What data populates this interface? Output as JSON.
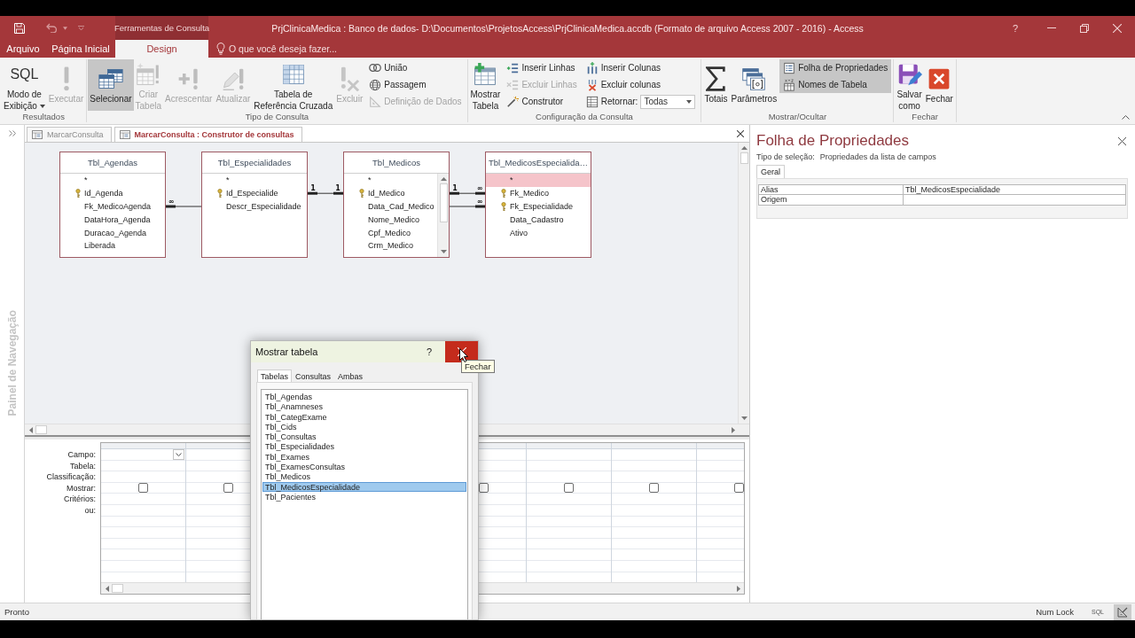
{
  "title_bar": {
    "context_label": "Ferramentas de Consulta",
    "title": "PrjClinicaMedica : Banco de dados- D:\\Documentos\\ProjetosAccess\\PrjClinicaMedica.accdb (Formato de arquivo Access 2007 - 2016) - Access",
    "help": "?"
  },
  "ribbon_tabs": [
    {
      "label": "Arquivo",
      "selected": false
    },
    {
      "label": "Página Inicial",
      "selected": false
    },
    {
      "label": "Design",
      "selected": true
    }
  ],
  "tell_me": {
    "placeholder": "O que você deseja fazer..."
  },
  "ribbon_groups": [
    {
      "label": "Resultados",
      "items": [
        {
          "kind": "large",
          "label": "Modo de\nExibição",
          "icon_text": "SQL",
          "dropdown": true,
          "selected": false,
          "disabled": false
        },
        {
          "kind": "large",
          "label": "Executar",
          "selected": false,
          "disabled": true
        }
      ]
    },
    {
      "label": "Tipo de Consulta",
      "items": [
        {
          "kind": "large",
          "label": "Selecionar",
          "selected": true,
          "disabled": false
        },
        {
          "kind": "large",
          "label": "Criar\nTabela",
          "selected": false,
          "disabled": true
        },
        {
          "kind": "large",
          "label": "Acrescentar",
          "selected": false,
          "disabled": true
        },
        {
          "kind": "large",
          "label": "Atualizar",
          "selected": false,
          "disabled": true
        },
        {
          "kind": "large",
          "label": "Tabela de\nReferência Cruzada",
          "selected": false,
          "disabled": false
        },
        {
          "kind": "large",
          "label": "Excluir",
          "selected": false,
          "disabled": true
        },
        {
          "kind": "stack",
          "items": [
            {
              "kind": "small",
              "label": "União",
              "selected": false,
              "disabled": false
            },
            {
              "kind": "small",
              "label": "Passagem",
              "selected": false,
              "disabled": false
            },
            {
              "kind": "small",
              "label": "Definição de Dados",
              "selected": false,
              "disabled": true
            }
          ]
        }
      ]
    },
    {
      "label": "Configuração da Consulta",
      "items": [
        {
          "kind": "large",
          "label": "Mostrar\nTabela",
          "selected": false,
          "disabled": false
        },
        {
          "kind": "stack",
          "items": [
            {
              "kind": "small",
              "label": "Inserir Linhas",
              "selected": false,
              "disabled": false
            },
            {
              "kind": "small",
              "label": "Excluir Linhas",
              "selected": false,
              "disabled": true
            },
            {
              "kind": "small",
              "label": "Construtor",
              "selected": false,
              "disabled": false
            }
          ]
        },
        {
          "kind": "stack",
          "items": [
            {
              "kind": "small",
              "label": "Inserir Colunas",
              "selected": false,
              "disabled": false
            },
            {
              "kind": "small",
              "label": "Excluir colunas",
              "selected": false,
              "disabled": false
            },
            {
              "kind": "combo",
              "label": "Retornar:",
              "value": "Todas",
              "disabled": false
            }
          ]
        }
      ]
    },
    {
      "label": "Mostrar/Ocultar",
      "items": [
        {
          "kind": "large",
          "label": "Totais",
          "selected": false,
          "disabled": false
        },
        {
          "kind": "large",
          "label": "Parâmetros",
          "selected": false,
          "disabled": false
        },
        {
          "kind": "stack",
          "items": [
            {
              "kind": "small",
              "label": "Folha de Propriedades",
              "selected": true,
              "disabled": false
            },
            {
              "kind": "small",
              "label": "Nomes de Tabela",
              "selected": true,
              "disabled": false
            }
          ]
        }
      ]
    },
    {
      "label": "Fechar",
      "items": [
        {
          "kind": "large",
          "label": "Salvar\ncomo",
          "selected": false,
          "disabled": false
        },
        {
          "kind": "large",
          "label": "Fechar",
          "selected": false,
          "disabled": false
        }
      ]
    }
  ],
  "nav_pane": {
    "title": "Painel de Navegação"
  },
  "doc_tabs": [
    {
      "label": "MarcarConsulta",
      "selected": false
    },
    {
      "label": "MarcarConsulta : Construtor de consultas",
      "selected": true
    }
  ],
  "designer": {
    "tables": [
      {
        "title": "Tbl_Agendas",
        "scrollbar": false,
        "fields": [
          {
            "name": "*",
            "key": false,
            "selected": false
          },
          {
            "name": "Id_Agenda",
            "key": true,
            "selected": false
          },
          {
            "name": "Fk_MedicoAgenda",
            "key": false,
            "selected": false,
            "join_right": {
              "kind": "cardinality",
              "end": "∞"
            }
          },
          {
            "name": "DataHora_Agenda",
            "key": false,
            "selected": false
          },
          {
            "name": "Duracao_Agenda",
            "key": false,
            "selected": false
          },
          {
            "name": "Liberada",
            "key": false,
            "selected": false
          }
        ]
      },
      {
        "title": "Tbl_Especialidades",
        "scrollbar": false,
        "fields": [
          {
            "name": "*",
            "key": false,
            "selected": false
          },
          {
            "name": "Id_Especialide",
            "key": true,
            "selected": false,
            "join_right": {
              "kind": "cardinality",
              "end": "1"
            }
          },
          {
            "name": "Descr_Especialidade",
            "key": false,
            "selected": false,
            "join_left": {
              "kind": "plain"
            }
          }
        ]
      },
      {
        "title": "Tbl_Medicos",
        "scrollbar": true,
        "fields": [
          {
            "name": "*",
            "key": false,
            "selected": false
          },
          {
            "name": "Id_Medico",
            "key": true,
            "selected": false,
            "join_left": {
              "kind": "cardinality",
              "end": "1"
            },
            "join_right": {
              "kind": "cardinality",
              "end": "1"
            }
          },
          {
            "name": "Data_Cad_Medico",
            "key": false,
            "selected": false,
            "join_right": {
              "kind": "plain"
            }
          },
          {
            "name": "Nome_Medico",
            "key": false,
            "selected": false
          },
          {
            "name": "Cpf_Medico",
            "key": false,
            "selected": false
          },
          {
            "name": "Crm_Medico",
            "key": false,
            "selected": false
          }
        ]
      },
      {
        "title": "Tbl_MedicosEspecialida…",
        "scrollbar": false,
        "fields": [
          {
            "name": "*",
            "key": false,
            "selected": true
          },
          {
            "name": "Fk_Medico",
            "key": true,
            "selected": false,
            "join_left": {
              "kind": "cardinality",
              "end": "∞"
            }
          },
          {
            "name": "Fk_Especialidade",
            "key": true,
            "selected": false,
            "join_left": {
              "kind": "cardinality",
              "end": "∞"
            }
          },
          {
            "name": "Data_Cadastro",
            "key": false,
            "selected": false
          },
          {
            "name": "Ativo",
            "key": false,
            "selected": false
          }
        ]
      }
    ]
  },
  "query_grid": {
    "row_labels": [
      "Campo:",
      "Tabela:",
      "Classificação:",
      "Mostrar:",
      "Critérios:",
      "ou:"
    ],
    "columns": [
      {
        "active": true,
        "checked": false
      },
      {
        "checked": false
      },
      {},
      {},
      {
        "active": false,
        "checked": false
      },
      {
        "active": false,
        "checked": false
      },
      {
        "active": false,
        "checked": false
      },
      {
        "active": false,
        "checked": false
      }
    ]
  },
  "properties": {
    "title": "Folha de Propriedades",
    "selection_label": "Tipo de seleção:",
    "selection_value": "Propriedades da lista de campos",
    "tabs": [
      {
        "label": "Geral",
        "selected": true
      }
    ],
    "rows": [
      {
        "name": "Alias",
        "value": "Tbl_MedicosEspecialidade"
      },
      {
        "name": "Origem"
      }
    ]
  },
  "dialog": {
    "title": "Mostrar tabela",
    "help": "?",
    "close_hovered": true,
    "tooltip": "Fechar",
    "tabs": [
      {
        "label": "Tabelas",
        "selected": true
      },
      {
        "label": "Consultas",
        "selected": false
      },
      {
        "label": "Ambas",
        "selected": false
      }
    ],
    "items": [
      {
        "label": "Tbl_Agendas",
        "selected": false
      },
      {
        "label": "Tbl_Anamneses",
        "selected": false
      },
      {
        "label": "Tbl_CategExame",
        "selected": false
      },
      {
        "label": "Tbl_Cids",
        "selected": false
      },
      {
        "label": "Tbl_Consultas",
        "selected": false
      },
      {
        "label": "Tbl_Especialidades",
        "selected": false
      },
      {
        "label": "Tbl_Exames",
        "selected": false
      },
      {
        "label": "Tbl_ExamesConsultas",
        "selected": false
      },
      {
        "label": "Tbl_Medicos",
        "selected": false
      },
      {
        "label": "Tbl_MedicosEspecialidade",
        "selected": true
      },
      {
        "label": "Tbl_Pacientes",
        "selected": false
      }
    ]
  },
  "status_bar": {
    "text": "Pronto",
    "indicators": [
      "Num Lock"
    ],
    "views": [
      {
        "kind": "sql",
        "label": "SQL",
        "selected": false
      },
      {
        "kind": "design",
        "selected": true
      }
    ]
  }
}
